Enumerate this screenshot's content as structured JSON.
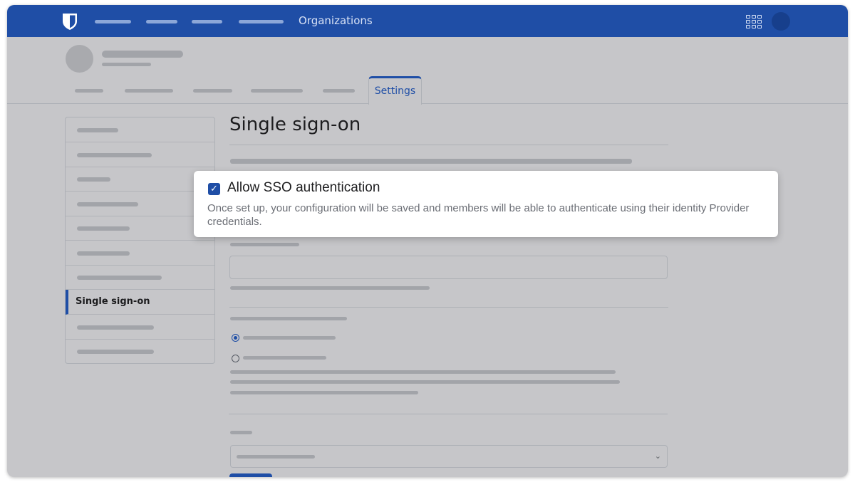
{
  "topbar": {
    "org_label": "Organizations",
    "icons": [
      "bitwarden-shield-logo",
      "apps-grid-icon",
      "user-avatar"
    ],
    "color": "#1f4ea6"
  },
  "org_header": {
    "active_tab_label": "Settings"
  },
  "sidebar": {
    "active_item_label": "Single sign-on",
    "active_index": 7
  },
  "main": {
    "page_title": "Single sign-on",
    "radio_selected_index": 0
  },
  "callout": {
    "checkbox_checked": true,
    "title": "Allow SSO authentication",
    "description": "Once set up, your configuration will be saved and members will be able to authenticate using their identity Provider credentials."
  },
  "colors": {
    "accent": "#1f4ea6",
    "overlay_bg": "#c6c6c9",
    "callout_bg": "#ffffff"
  }
}
